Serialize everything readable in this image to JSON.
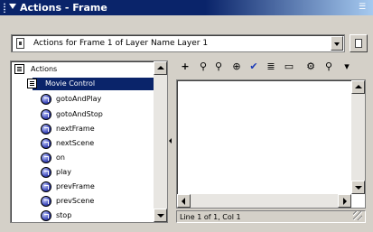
{
  "panel": {
    "title": "Actions - Frame",
    "menu_icon": "panel-menu-icon"
  },
  "selector": {
    "value": "Actions for Frame 1 of Layer Name Layer 1",
    "icon": "frame-script-icon",
    "pin_icon": "pin-script-icon"
  },
  "tree": {
    "root_label": "Actions",
    "group_label": "Movie Control",
    "items": [
      {
        "label": "gotoAndPlay"
      },
      {
        "label": "gotoAndStop"
      },
      {
        "label": "nextFrame"
      },
      {
        "label": "nextScene"
      },
      {
        "label": "on"
      },
      {
        "label": "play"
      },
      {
        "label": "prevFrame"
      },
      {
        "label": "prevScene"
      },
      {
        "label": "stop"
      }
    ]
  },
  "toolbar": {
    "buttons": [
      {
        "name": "add-statement-icon",
        "glyph": "+"
      },
      {
        "name": "find-icon",
        "glyph": "⚲"
      },
      {
        "name": "replace-icon",
        "glyph": "⚲"
      },
      {
        "name": "target-path-icon",
        "glyph": "⊕"
      },
      {
        "name": "check-syntax-icon",
        "glyph": "✔"
      },
      {
        "name": "auto-format-icon",
        "glyph": "≣"
      },
      {
        "name": "code-hint-icon",
        "glyph": "▭"
      },
      {
        "name": "debug-options-icon",
        "glyph": "⚙"
      },
      {
        "name": "reference-icon",
        "glyph": "⚲"
      },
      {
        "name": "view-options-icon",
        "glyph": "▾"
      }
    ]
  },
  "status": {
    "text": "Line 1 of 1, Col 1"
  }
}
